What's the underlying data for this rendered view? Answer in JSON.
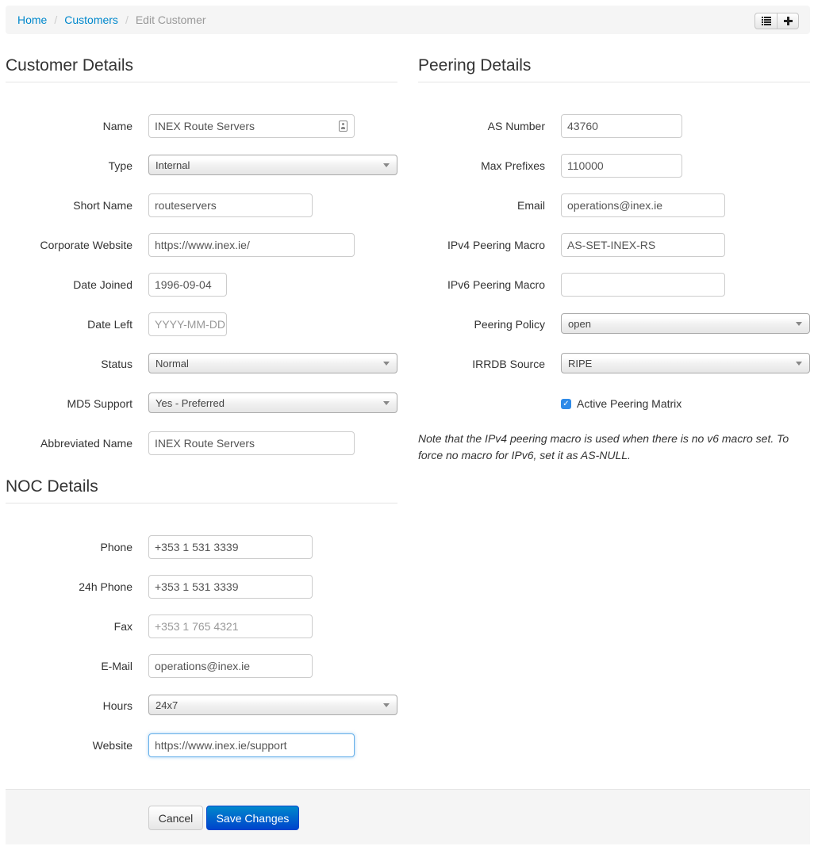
{
  "breadcrumb": {
    "home": "Home",
    "customers": "Customers",
    "current": "Edit Customer",
    "list_icon": "list-icon",
    "add_icon": "plus-icon"
  },
  "customer": {
    "title": "Customer Details",
    "name_label": "Name",
    "name_value": "INEX Route Servers",
    "type_label": "Type",
    "type_value": "Internal",
    "short_label": "Short Name",
    "short_value": "routeservers",
    "website_label": "Corporate Website",
    "website_value": "https://www.inex.ie/",
    "joined_label": "Date Joined",
    "joined_value": "1996-09-04",
    "left_label": "Date Left",
    "left_placeholder": "YYYY-MM-DD",
    "status_label": "Status",
    "status_value": "Normal",
    "md5_label": "MD5 Support",
    "md5_value": "Yes - Preferred",
    "abbrev_label": "Abbreviated Name",
    "abbrev_value": "INEX Route Servers"
  },
  "noc": {
    "title": "NOC Details",
    "phone_label": "Phone",
    "phone_value": "+353 1 531 3339",
    "phone24_label": "24h Phone",
    "phone24_value": "+353 1 531 3339",
    "fax_label": "Fax",
    "fax_placeholder": "+353 1 765 4321",
    "email_label": "E-Mail",
    "email_value": "operations@inex.ie",
    "hours_label": "Hours",
    "hours_value": "24x7",
    "website_label": "Website",
    "website_value": "https://www.inex.ie/support"
  },
  "peering": {
    "title": "Peering Details",
    "asn_label": "AS Number",
    "asn_value": "43760",
    "maxpfx_label": "Max Prefixes",
    "maxpfx_value": "110000",
    "email_label": "Email",
    "email_value": "operations@inex.ie",
    "v4macro_label": "IPv4 Peering Macro",
    "v4macro_value": "AS-SET-INEX-RS",
    "v6macro_label": "IPv6 Peering Macro",
    "v6macro_value": "",
    "policy_label": "Peering Policy",
    "policy_value": "open",
    "irrdb_label": "IRRDB Source",
    "irrdb_value": "RIPE",
    "matrix_label": "Active Peering Matrix",
    "note": "Note that the IPv4 peering macro is used when there is no v6 macro set. To force no macro for IPv6, set it as AS-NULL."
  },
  "actions": {
    "cancel": "Cancel",
    "save": "Save Changes"
  }
}
